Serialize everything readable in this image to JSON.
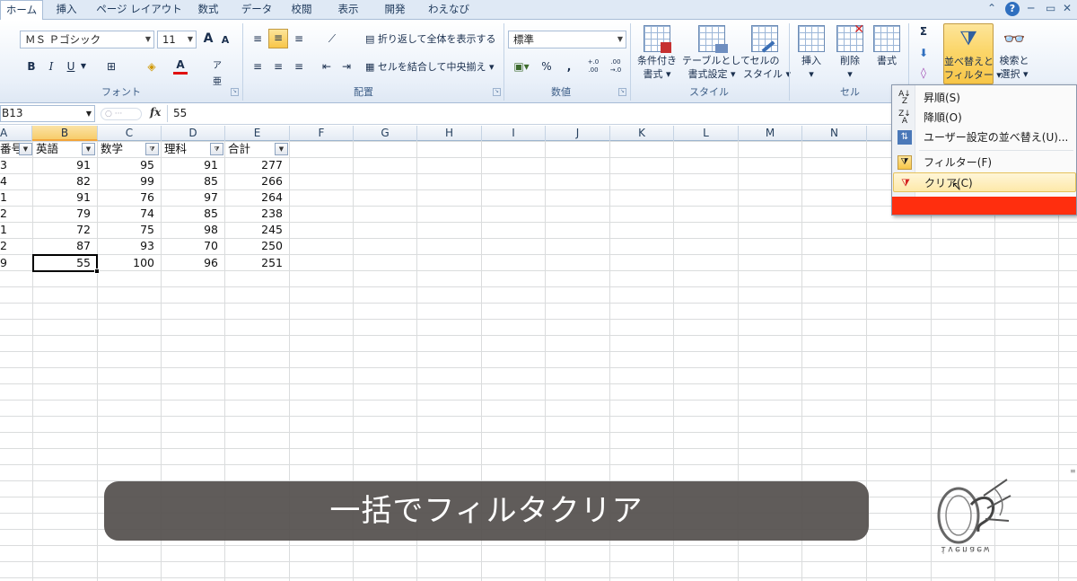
{
  "tabs": [
    "ホーム",
    "挿入",
    "ページ レイアウト",
    "数式",
    "データ",
    "校閲",
    "表示",
    "開発",
    "わえなび"
  ],
  "window_controls": {
    "help": "?",
    "minimize": "─",
    "restore": "▭"
  },
  "ribbon": {
    "font": {
      "name": "ＭＳ Ｐゴシック",
      "size": "11",
      "grow": "A",
      "shrink": "A",
      "bold": "B",
      "italic": "I",
      "underline": "U",
      "font_color": "A",
      "group_label": "フォント"
    },
    "alignment": {
      "wrap_text": "折り返して全体を表示する",
      "merge_center": "セルを結合して中央揃え",
      "group_label": "配置"
    },
    "number": {
      "format": "標準",
      "percent": "%",
      "comma": ",",
      "inc_decimal": "+.0 .00",
      "dec_decimal": ".00 →.0",
      "group_label": "数値"
    },
    "styles": {
      "conditional": [
        "条件付き",
        "書式"
      ],
      "table": [
        "テーブルとして",
        "書式設定"
      ],
      "cell_styles": [
        "セルの",
        "スタイル"
      ],
      "group_label": "スタイル"
    },
    "cells": {
      "insert": "挿入",
      "delete": "削除",
      "format": "書式",
      "group_label": "セル"
    },
    "editing": {
      "sum": "Σ",
      "sort_filter": [
        "並べ替えと",
        "フィルター"
      ],
      "find_select": [
        "検索と",
        "選択"
      ]
    }
  },
  "formula_bar": {
    "name_box": "B13",
    "fx": "fx",
    "value": "55"
  },
  "columns": [
    "A",
    "B",
    "C",
    "D",
    "E",
    "F",
    "G",
    "H",
    "I",
    "J",
    "K",
    "L",
    "M",
    "N"
  ],
  "selected_column": "B",
  "table": {
    "headers": [
      "番号",
      "英語",
      "数学",
      "理科",
      "合計"
    ],
    "rows": [
      [
        "3",
        "91",
        "95",
        "91",
        "277"
      ],
      [
        "4",
        "82",
        "99",
        "85",
        "266"
      ],
      [
        "1",
        "91",
        "76",
        "97",
        "264"
      ],
      [
        "2",
        "79",
        "74",
        "85",
        "238"
      ],
      [
        "1",
        "72",
        "75",
        "98",
        "245"
      ],
      [
        "2",
        "87",
        "93",
        "70",
        "250"
      ],
      [
        "9",
        "55",
        "100",
        "96",
        "251"
      ]
    ]
  },
  "menu": {
    "items": [
      {
        "icon": "sort-ascending-icon",
        "label": "昇順(S)"
      },
      {
        "icon": "sort-descending-icon",
        "label": "降順(O)"
      },
      {
        "icon": "custom-sort-icon",
        "label": "ユーザー設定の並べ替え(U)..."
      },
      {
        "icon": "filter-icon",
        "label": "フィルター(F)"
      },
      {
        "icon": "clear-filter-icon",
        "label": "クリア(C)"
      }
    ],
    "hover_index": 4
  },
  "caption": "一括でフィルタクリア",
  "logo_text": "ivenaew",
  "colors": {
    "ribbon_bg": "#e9f0f9",
    "selected_header": "#f7cd6b",
    "menu_hover": "#fde9a9",
    "red_bar": "#ff2e0e",
    "caption_bg": "#54504d"
  }
}
